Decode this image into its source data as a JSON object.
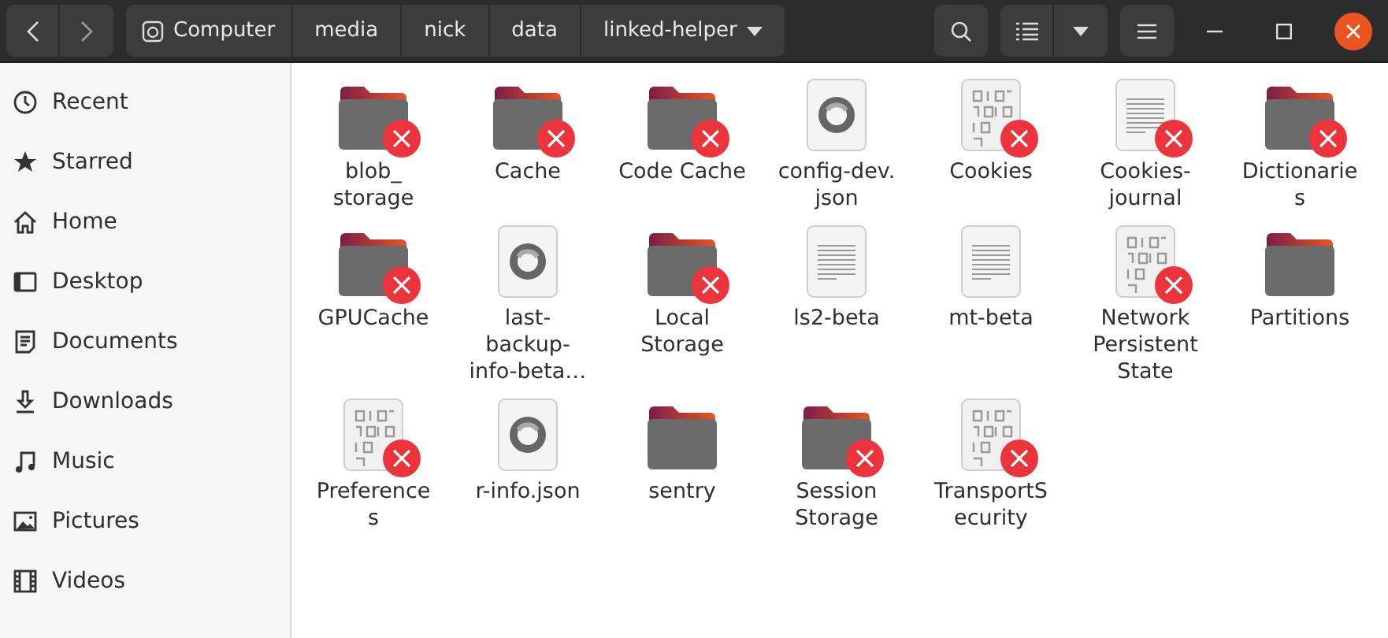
{
  "header": {
    "path": [
      {
        "label": "Computer",
        "kind": "root"
      },
      {
        "label": "media",
        "kind": "dir"
      },
      {
        "label": "nick",
        "kind": "dir"
      },
      {
        "label": "data",
        "kind": "dir"
      },
      {
        "label": "linked-helper",
        "kind": "current"
      }
    ]
  },
  "sidebar": {
    "items": [
      {
        "label": "Recent",
        "kind": "recent"
      },
      {
        "label": "Starred",
        "kind": "starred"
      },
      {
        "label": "Home",
        "kind": "home"
      },
      {
        "label": "Desktop",
        "kind": "desktop"
      },
      {
        "label": "Documents",
        "kind": "documents"
      },
      {
        "label": "Downloads",
        "kind": "downloads"
      },
      {
        "label": "Music",
        "kind": "music"
      },
      {
        "label": "Pictures",
        "kind": "pictures"
      },
      {
        "label": "Videos",
        "kind": "videos"
      }
    ]
  },
  "files": [
    {
      "lines": [
        "blob_",
        "storage"
      ],
      "kind": "folder",
      "locked": true
    },
    {
      "lines": [
        "Cache"
      ],
      "kind": "folder",
      "locked": true
    },
    {
      "lines": [
        "Code Cache"
      ],
      "kind": "folder",
      "locked": true
    },
    {
      "lines": [
        "config-dev.",
        "json"
      ],
      "kind": "json",
      "locked": false
    },
    {
      "lines": [
        "Cookies"
      ],
      "kind": "binary",
      "locked": true
    },
    {
      "lines": [
        "Cookies-",
        "journal"
      ],
      "kind": "text",
      "locked": true
    },
    {
      "lines": [
        "Dictionarie",
        "s"
      ],
      "kind": "folder",
      "locked": true
    },
    {
      "lines": [
        "GPUCache"
      ],
      "kind": "folder",
      "locked": true
    },
    {
      "lines": [
        "last-",
        "backup-",
        "info-beta…"
      ],
      "kind": "json",
      "locked": false
    },
    {
      "lines": [
        "Local",
        "Storage"
      ],
      "kind": "folder",
      "locked": true
    },
    {
      "lines": [
        "ls2-beta"
      ],
      "kind": "text",
      "locked": false
    },
    {
      "lines": [
        "mt-beta"
      ],
      "kind": "text",
      "locked": false
    },
    {
      "lines": [
        "Network",
        "Persistent",
        "State"
      ],
      "kind": "binary",
      "locked": true
    },
    {
      "lines": [
        "Partitions"
      ],
      "kind": "folder",
      "locked": false
    },
    {
      "lines": [
        "Preference",
        "s"
      ],
      "kind": "binary",
      "locked": true
    },
    {
      "lines": [
        "r-info.json"
      ],
      "kind": "json",
      "locked": false
    },
    {
      "lines": [
        "sentry"
      ],
      "kind": "folder",
      "locked": false
    },
    {
      "lines": [
        "Session",
        "Storage"
      ],
      "kind": "folder",
      "locked": true
    },
    {
      "lines": [
        "TransportS",
        "ecurity"
      ],
      "kind": "binary",
      "locked": true
    }
  ]
}
